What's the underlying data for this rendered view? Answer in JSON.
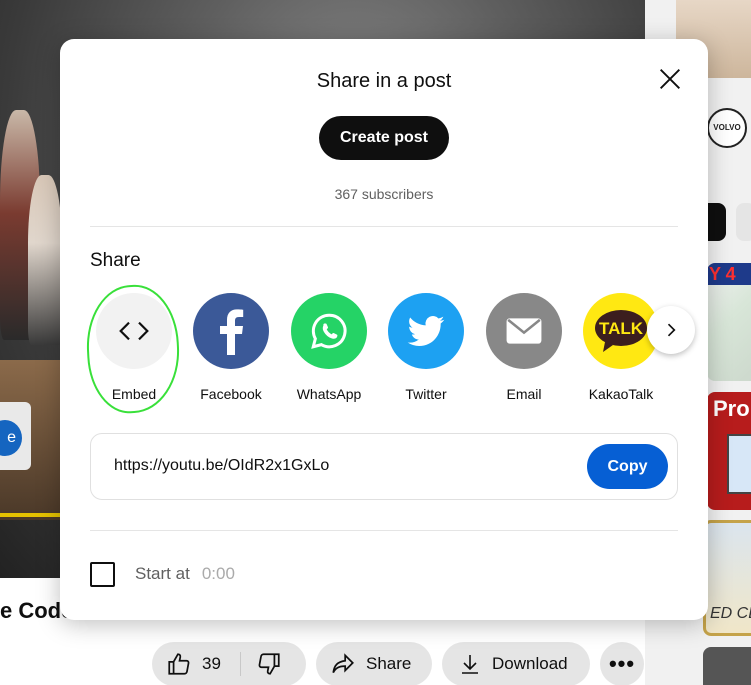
{
  "background": {
    "video_title_fragment": "e Code",
    "side_button_label": "e",
    "like_count": "39",
    "share_label": "Share",
    "download_label": "Download",
    "more_label": "•••",
    "thumbs": {
      "volvo_logo": "VOLVO",
      "t2_text": "Y 4",
      "t3_text": "Pro",
      "t4_text": "ED CL"
    }
  },
  "modal": {
    "title": "Share in a post",
    "create_post_label": "Create post",
    "subscribers": "367 subscribers",
    "share_section_label": "Share",
    "share_targets": [
      {
        "label": "Embed",
        "icon": "embed-icon"
      },
      {
        "label": "Facebook",
        "icon": "facebook-icon"
      },
      {
        "label": "WhatsApp",
        "icon": "whatsapp-icon"
      },
      {
        "label": "Twitter",
        "icon": "twitter-icon"
      },
      {
        "label": "Email",
        "icon": "email-icon"
      },
      {
        "label": "KakaoTalk",
        "icon": "kakaotalk-icon",
        "icon_text": "TALK"
      }
    ],
    "url": "https://youtu.be/OIdR2x1GxLo",
    "copy_label": "Copy",
    "start_at_label": "Start at",
    "start_at_value": "0:00"
  },
  "colors": {
    "copy_blue": "#065fd4",
    "facebook": "#3b5998",
    "whatsapp": "#25d366",
    "twitter": "#1da1f2",
    "email": "#888888",
    "kakaotalk": "#ffe812",
    "annotation_green": "#39e03a"
  }
}
